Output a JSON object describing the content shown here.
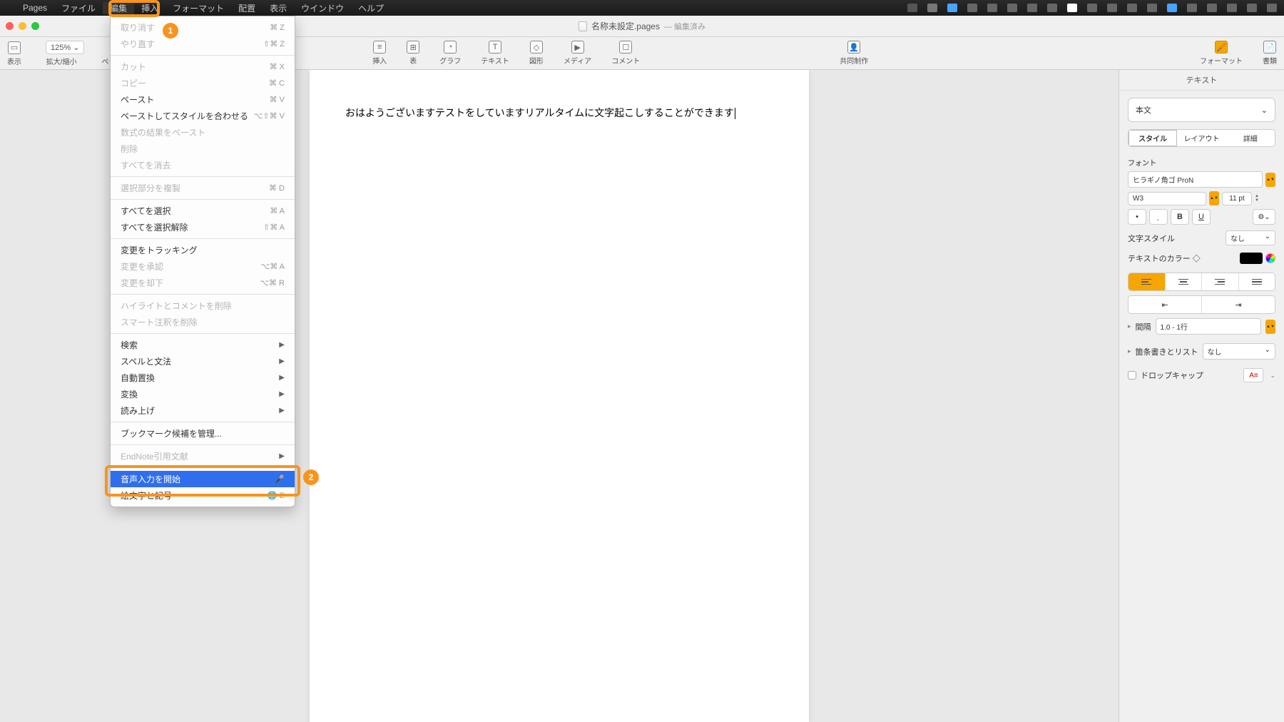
{
  "menubar": {
    "app": "Pages",
    "items": [
      "ファイル",
      "編集",
      "挿入",
      "フォーマット",
      "配置",
      "表示",
      "ウインドウ",
      "ヘルプ"
    ]
  },
  "window": {
    "title": "名称未設定.pages",
    "edited": "— 編集済み"
  },
  "toolbar": {
    "view": "表示",
    "zoom_label": "拡大/縮小",
    "zoom_value": "125%",
    "pages": "ページを追加",
    "insert": "挿入",
    "table": "表",
    "chart": "グラフ",
    "text": "テキスト",
    "shape": "図形",
    "media": "メディア",
    "comment": "コメント",
    "collab": "共同制作",
    "format": "フォーマット",
    "document": "書類"
  },
  "document": {
    "body": "おはようございますテストをしていますリアルタイムに文字起こしすることができます"
  },
  "inspector": {
    "tab_label": "テキスト",
    "paragraph_style": "本文",
    "seg_style": "スタイル",
    "seg_layout": "レイアウト",
    "seg_detail": "詳細",
    "font_label": "フォント",
    "font_name": "ヒラギノ角ゴ ProN",
    "font_weight": "W3",
    "font_size": "11 pt",
    "char_style_label": "文字スタイル",
    "char_style_value": "なし",
    "text_color_label": "テキストのカラー ◇",
    "spacing_label": "間隔",
    "spacing_value": "1.0 - 1行",
    "bullets_label": "箇条書きとリスト",
    "bullets_value": "なし",
    "dropcap_label": "ドロップキャップ",
    "dropcap_preview": "A"
  },
  "dropdown": {
    "items": [
      {
        "label": "取り消す",
        "shortcut": "⌘ Z",
        "disabled": true
      },
      {
        "label": "やり直す",
        "shortcut": "⇧⌘ Z",
        "disabled": true
      },
      {
        "sep": true
      },
      {
        "label": "カット",
        "shortcut": "⌘ X",
        "disabled": true
      },
      {
        "label": "コピー",
        "shortcut": "⌘ C",
        "disabled": true
      },
      {
        "label": "ペースト",
        "shortcut": "⌘ V",
        "disabled": false
      },
      {
        "label": "ペーストしてスタイルを合わせる",
        "shortcut": "⌥⇧⌘ V",
        "disabled": false
      },
      {
        "label": "数式の結果をペースト",
        "shortcut": "",
        "disabled": true
      },
      {
        "label": "削除",
        "shortcut": "",
        "disabled": true
      },
      {
        "label": "すべてを消去",
        "shortcut": "",
        "disabled": true
      },
      {
        "sep": true
      },
      {
        "label": "選択部分を複製",
        "shortcut": "⌘ D",
        "disabled": true
      },
      {
        "sep": true
      },
      {
        "label": "すべてを選択",
        "shortcut": "⌘ A",
        "disabled": false
      },
      {
        "label": "すべてを選択解除",
        "shortcut": "⇧⌘ A",
        "disabled": false
      },
      {
        "sep": true
      },
      {
        "label": "変更をトラッキング",
        "shortcut": "",
        "disabled": false
      },
      {
        "label": "変更を承認",
        "shortcut": "⌥⌘ A",
        "disabled": true
      },
      {
        "label": "変更を却下",
        "shortcut": "⌥⌘ R",
        "disabled": true
      },
      {
        "sep": true
      },
      {
        "label": "ハイライトとコメントを削除",
        "shortcut": "",
        "disabled": true
      },
      {
        "label": "スマート注釈を削除",
        "shortcut": "",
        "disabled": true
      },
      {
        "sep": true
      },
      {
        "label": "検索",
        "submenu": true,
        "disabled": false
      },
      {
        "label": "スペルと文法",
        "submenu": true,
        "disabled": false
      },
      {
        "label": "自動置換",
        "submenu": true,
        "disabled": false
      },
      {
        "label": "変換",
        "submenu": true,
        "disabled": false
      },
      {
        "label": "読み上げ",
        "submenu": true,
        "disabled": false
      },
      {
        "sep": true
      },
      {
        "label": "ブックマーク候補を管理...",
        "shortcut": "",
        "disabled": false
      },
      {
        "sep": true
      },
      {
        "label": "EndNote引用文献",
        "submenu": true,
        "disabled": true
      },
      {
        "sep": true
      },
      {
        "label": "音声入力を開始",
        "shortcut": "🎤",
        "selected": true,
        "disabled": false
      },
      {
        "label": "絵文字と記号",
        "shortcut": "🌐 E",
        "disabled": false
      }
    ]
  },
  "annotations": {
    "badge1": "1",
    "badge2": "2"
  }
}
